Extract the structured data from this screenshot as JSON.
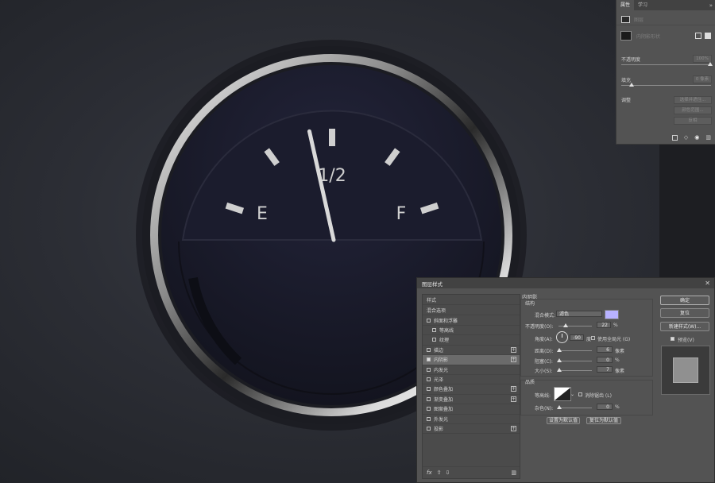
{
  "gauge": {
    "left_label": "E",
    "center_label": "1/2",
    "right_label": "F",
    "needle_level": 0.43
  },
  "properties_panel": {
    "tabs": [
      {
        "label": "属性"
      },
      {
        "label": "学习"
      }
    ],
    "type_label": "图层",
    "layer_label": "内阴影形状",
    "opacity_label": "不透明度",
    "opacity_value": "100%",
    "fill_label": "填充",
    "fill_value": "0 像素",
    "adjust_label": "调整",
    "buttons": [
      {
        "label": "选择并遮住..."
      },
      {
        "label": "颜色范围..."
      },
      {
        "label": "反相"
      }
    ]
  },
  "layer_style_dialog": {
    "title": "图层样式",
    "styles_header": "样式",
    "blend_options": "混合选项",
    "list": [
      {
        "label": "斜面和浮雕",
        "checked": false,
        "plus": false,
        "indent": false
      },
      {
        "label": "等高线",
        "checked": false,
        "plus": false,
        "indent": true
      },
      {
        "label": "纹理",
        "checked": false,
        "plus": false,
        "indent": true
      },
      {
        "label": "描边",
        "checked": false,
        "plus": true,
        "indent": false
      },
      {
        "label": "内阴影",
        "checked": true,
        "plus": true,
        "indent": false,
        "selected": true
      },
      {
        "label": "内发光",
        "checked": false,
        "plus": false,
        "indent": false
      },
      {
        "label": "光泽",
        "checked": false,
        "plus": false,
        "indent": false
      },
      {
        "label": "颜色叠加",
        "checked": false,
        "plus": true,
        "indent": false
      },
      {
        "label": "渐变叠加",
        "checked": false,
        "plus": true,
        "indent": false
      },
      {
        "label": "图案叠加",
        "checked": false,
        "plus": false,
        "indent": false
      },
      {
        "label": "外发光",
        "checked": false,
        "plus": false,
        "indent": false
      },
      {
        "label": "投影",
        "checked": false,
        "plus": true,
        "indent": false
      }
    ],
    "section_title": "内阴影",
    "structure_title": "结构",
    "blend_mode_label": "混合模式:",
    "blend_mode_value": "滤色",
    "shadow_color": "#b8b2ff",
    "opacity_label": "不透明度(O):",
    "opacity_value": "22",
    "opacity_level": 0.22,
    "percent": "%",
    "angle_label": "角度(A):",
    "angle_value": "-90",
    "degree_unit": "度",
    "global_light_label": "使用全局光 (G)",
    "distance_label": "距离(D):",
    "distance_value": "6",
    "choke_label": "阻塞(C):",
    "choke_value": "0",
    "size_label": "大小(S):",
    "size_value": "7",
    "px_unit": "像素",
    "quality_title": "品质",
    "contour_label": "等高线:",
    "antialias_label": "消除锯齿 (L)",
    "noise_label": "杂色(N):",
    "noise_value": "0",
    "set_default": "设置为默认值",
    "reset_default": "复位为默认值",
    "ok": "确定",
    "reset": "复位",
    "new_style": "新建样式(W)...",
    "preview_label": "预览(V)",
    "fx_label": "fx"
  }
}
